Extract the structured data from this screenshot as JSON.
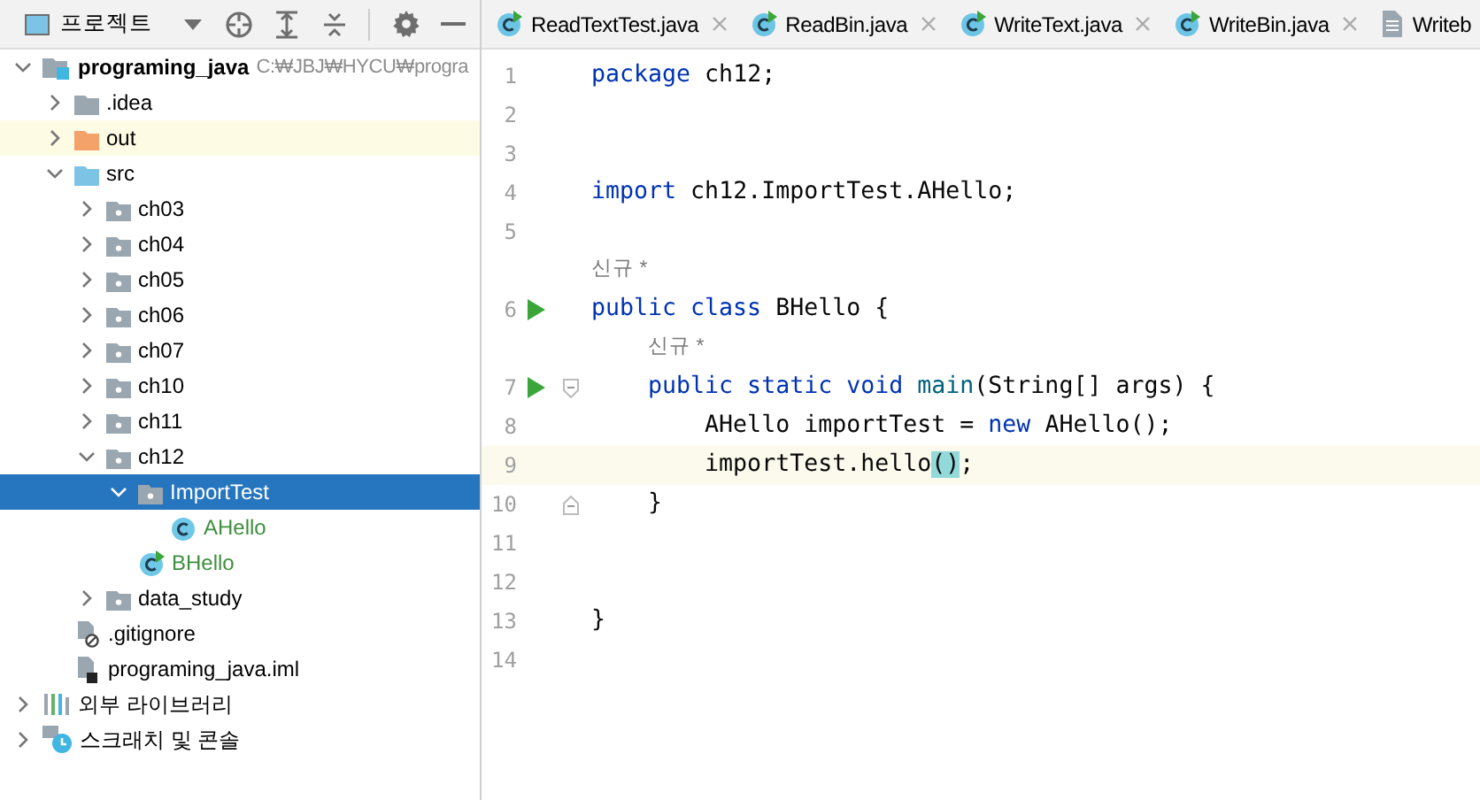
{
  "project_panel": {
    "title": "프로젝트",
    "tree": [
      {
        "label": "programing_java",
        "path": "C:₩JBJ₩HYCU₩progra",
        "kind": "module",
        "bold": true,
        "expanded": true,
        "selected": false,
        "hovered": false,
        "children": [
          {
            "label": ".idea",
            "kind": "folder",
            "expanded": false,
            "selected": false,
            "hovered": false
          },
          {
            "label": "out",
            "kind": "excluded-folder",
            "expanded": false,
            "selected": false,
            "hovered": true
          },
          {
            "label": "src",
            "kind": "source-folder",
            "expanded": true,
            "selected": false,
            "hovered": false,
            "children": [
              {
                "label": "ch03",
                "kind": "package",
                "expanded": false,
                "selected": false,
                "hovered": false
              },
              {
                "label": "ch04",
                "kind": "package",
                "expanded": false,
                "selected": false,
                "hovered": false
              },
              {
                "label": "ch05",
                "kind": "package",
                "expanded": false,
                "selected": false,
                "hovered": false
              },
              {
                "label": "ch06",
                "kind": "package",
                "expanded": false,
                "selected": false,
                "hovered": false
              },
              {
                "label": "ch07",
                "kind": "package",
                "expanded": false,
                "selected": false,
                "hovered": false
              },
              {
                "label": "ch10",
                "kind": "package",
                "expanded": false,
                "selected": false,
                "hovered": false
              },
              {
                "label": "ch11",
                "kind": "package",
                "expanded": false,
                "selected": false,
                "hovered": false
              },
              {
                "label": "ch12",
                "kind": "package",
                "expanded": true,
                "selected": false,
                "hovered": false,
                "children": [
                  {
                    "label": "ImportTest",
                    "kind": "package",
                    "expanded": true,
                    "selected": true,
                    "hovered": false,
                    "children": [
                      {
                        "label": "AHello",
                        "kind": "class",
                        "color": "#3e8f3e",
                        "selected": false,
                        "hovered": false
                      }
                    ]
                  },
                  {
                    "label": "BHello",
                    "kind": "main-class",
                    "color": "#3e8f3e",
                    "selected": false,
                    "hovered": false
                  }
                ]
              },
              {
                "label": "data_study",
                "kind": "package",
                "expanded": false,
                "selected": false,
                "hovered": false
              }
            ]
          },
          {
            "label": ".gitignore",
            "kind": "ignore-file",
            "selected": false,
            "hovered": false
          },
          {
            "label": "programing_java.iml",
            "kind": "module-file",
            "selected": false,
            "hovered": false
          }
        ]
      },
      {
        "label": "외부 라이브러리",
        "kind": "libraries",
        "expanded": false,
        "selected": false,
        "hovered": false
      },
      {
        "label": "스크래치 및 콘솔",
        "kind": "scratches",
        "expanded": false,
        "selected": false,
        "hovered": false
      }
    ]
  },
  "editor": {
    "tabs": [
      {
        "label": "ReadTextTest.java",
        "kind": "main-class",
        "selected": false,
        "closable": true
      },
      {
        "label": "ReadBin.java",
        "kind": "main-class",
        "selected": false,
        "closable": true
      },
      {
        "label": "WriteText.java",
        "kind": "main-class",
        "selected": false,
        "closable": true
      },
      {
        "label": "WriteBin.java",
        "kind": "main-class",
        "selected": false,
        "closable": true
      },
      {
        "label": "Writeb",
        "kind": "text-file",
        "selected": false
      }
    ],
    "lines": [
      {
        "kind": "code",
        "number": "1",
        "tokens": [
          {
            "text": "package",
            "kind": "keyword"
          },
          {
            "text": " ch12;",
            "kind": "plain"
          }
        ]
      },
      {
        "kind": "code",
        "number": "2"
      },
      {
        "kind": "code",
        "number": "3"
      },
      {
        "kind": "code",
        "number": "4",
        "tokens": [
          {
            "text": "import",
            "kind": "keyword"
          },
          {
            "text": " ch12.ImportTest.AHello;",
            "kind": "plain"
          }
        ]
      },
      {
        "kind": "code",
        "number": "5"
      },
      {
        "kind": "hint",
        "text": "신규 *"
      },
      {
        "kind": "code",
        "number": "6",
        "run": true,
        "tokens": [
          {
            "text": "public class",
            "kind": "keyword"
          },
          {
            "text": " BHello {",
            "kind": "plain"
          }
        ]
      },
      {
        "kind": "hint",
        "text": "신규 *"
      },
      {
        "kind": "code",
        "number": "7",
        "run": true,
        "fold_start": true,
        "tokens": [
          {
            "text": "    public static void",
            "kind": "keyword"
          },
          {
            "text": " main",
            "kind": "method"
          },
          {
            "text": "(String[] args) {",
            "kind": "plain"
          }
        ]
      },
      {
        "kind": "code",
        "number": "8",
        "tokens": [
          {
            "text": "        AHello importTest = ",
            "kind": "plain"
          },
          {
            "text": "new",
            "kind": "keyword"
          },
          {
            "text": " AHello();",
            "kind": "plain"
          }
        ]
      },
      {
        "kind": "code",
        "number": "9",
        "current": true,
        "tokens": [
          {
            "text": "        importTest.hello",
            "kind": "plain"
          },
          {
            "text": "()",
            "kind": "match"
          },
          {
            "text": ";",
            "kind": "plain"
          }
        ]
      },
      {
        "kind": "code",
        "number": "10",
        "fold_end": true,
        "tokens": [
          {
            "text": "    }",
            "kind": "plain"
          }
        ]
      },
      {
        "kind": "code",
        "number": "11"
      },
      {
        "kind": "code",
        "number": "12"
      },
      {
        "kind": "code",
        "number": "13",
        "tokens": [
          {
            "text": "}",
            "kind": "plain"
          }
        ]
      },
      {
        "kind": "code",
        "number": "14"
      }
    ]
  }
}
